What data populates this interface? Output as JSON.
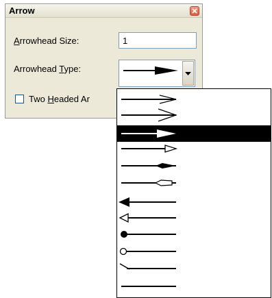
{
  "dialog": {
    "title": "Arrow",
    "size_label_mnemonic": "A",
    "size_label_rest": "rrowhead Size:",
    "size_value": "1",
    "type_label_pre": "Arrowhead ",
    "type_label_mnemonic": "T",
    "type_label_post": "ype:",
    "two_headed_pre": "Two ",
    "two_headed_mnemonic": "H",
    "two_headed_post": "eaded Ar",
    "two_headed_checked": false
  },
  "dropdown": {
    "selected_index": 2,
    "options": [
      "open-arrow-right",
      "open-arrow-right-large",
      "filled-arrow-right",
      "hollow-triangle-right",
      "filled-diamond-right",
      "hollow-diamond-right",
      "filled-arrow-left",
      "hollow-triangle-left",
      "filled-circle-left",
      "hollow-circle-left",
      "slash-left",
      "plain-line"
    ]
  },
  "colors": {
    "selection": "#000000",
    "dialog_bg": "#ece9d8",
    "close_red": "#dd5b43"
  }
}
